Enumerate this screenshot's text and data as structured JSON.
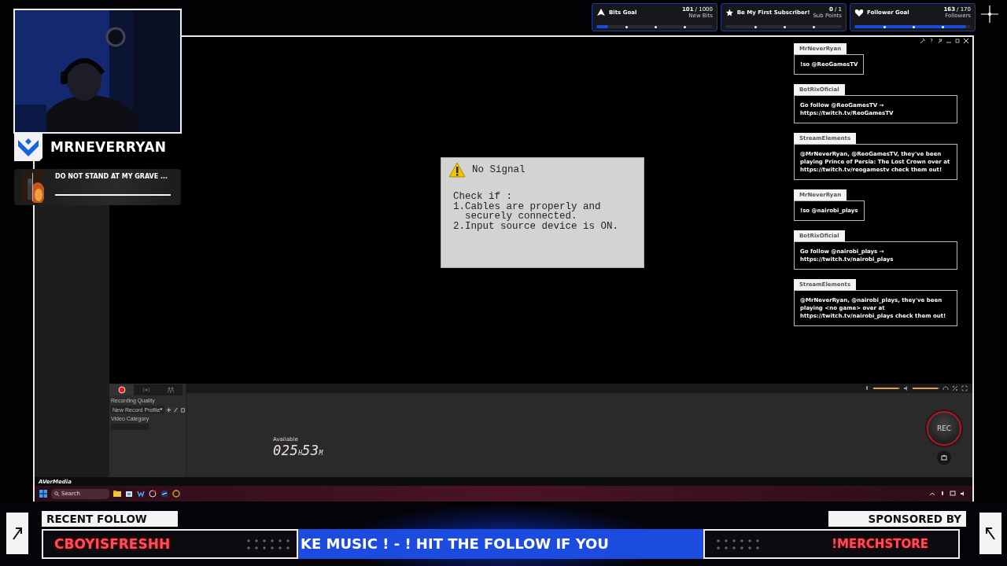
{
  "channel": {
    "name": "MRNEVERRYAN"
  },
  "now_playing": {
    "title": "DO NOT STAND AT MY GRAVE ...",
    "level": 1
  },
  "goals": [
    {
      "kind": "bits",
      "title": "Bits Goal",
      "current": "101",
      "target": "/ 1000",
      "unit": "New Bits",
      "level": 0.1
    },
    {
      "kind": "star",
      "title": "Be My First Subscriber!",
      "current": "0",
      "target": "/ 1",
      "unit": "Sub Points",
      "level": 0
    },
    {
      "kind": "heart",
      "title": "Follower Goal",
      "current": "163",
      "target": "/ 170",
      "unit": "Followers",
      "level": 0.96
    }
  ],
  "no_signal": {
    "title": "No Signal",
    "intro": "Check if :",
    "items": [
      "1.Cables are properly and securely connected.",
      "2.Input source device is ON."
    ]
  },
  "chat": [
    {
      "user": "MrNeverRyan",
      "message": "!so @ReoGamesTV"
    },
    {
      "user": "BotRixOficial",
      "message": "Go follow @ReoGamesTV → https://twitch.tv/ReoGamesTV"
    },
    {
      "user": "StreamElements",
      "message": "@MrNeverRyan, @ReoGamesTV, they've been playing Prince of Persia: The Lost Crown over at https://twitch.tv/reogamestv check them out!"
    },
    {
      "user": "MrNeverRyan",
      "message": "!so @nairobi_plays"
    },
    {
      "user": "BotRixOficial",
      "message": "Go follow @nairobi_plays → https://twitch.tv/nairobi_plays"
    },
    {
      "user": "StreamElements",
      "message": "@MrNeverRyan, @nairobi_plays, they've been playing <no game> over at https://twitch.tv/nairobi_plays check them out!"
    }
  ],
  "record_panel": {
    "tabs": [
      {
        "kind": "record",
        "selected": true
      },
      {
        "kind": "broadcast",
        "selected": false
      },
      {
        "kind": "people",
        "selected": false
      }
    ],
    "quality_label": "Recording Quality",
    "profile": "New Record Profile",
    "category_label": "Video Category"
  },
  "available": {
    "label": "Available",
    "hours": "025",
    "hours_unit": "H",
    "minutes": "53",
    "minutes_unit": "M"
  },
  "mixer": [
    {
      "kind": "mic",
      "level": 0.95
    },
    {
      "kind": "speaker",
      "level": 0.95
    }
  ],
  "rec_button": "REC",
  "brand": "AVerMedia",
  "taskbar": {
    "search": "Search"
  },
  "footer": {
    "recent_label": "RECENT FOLLOW",
    "recent_name": "CBOYISFRESHH",
    "ticker": "KE MUSIC ! - ! HIT THE FOLLOW IF YOU",
    "sponsor_label": "SPONSORED BY",
    "sponsor": "!MERCHSTORE"
  }
}
